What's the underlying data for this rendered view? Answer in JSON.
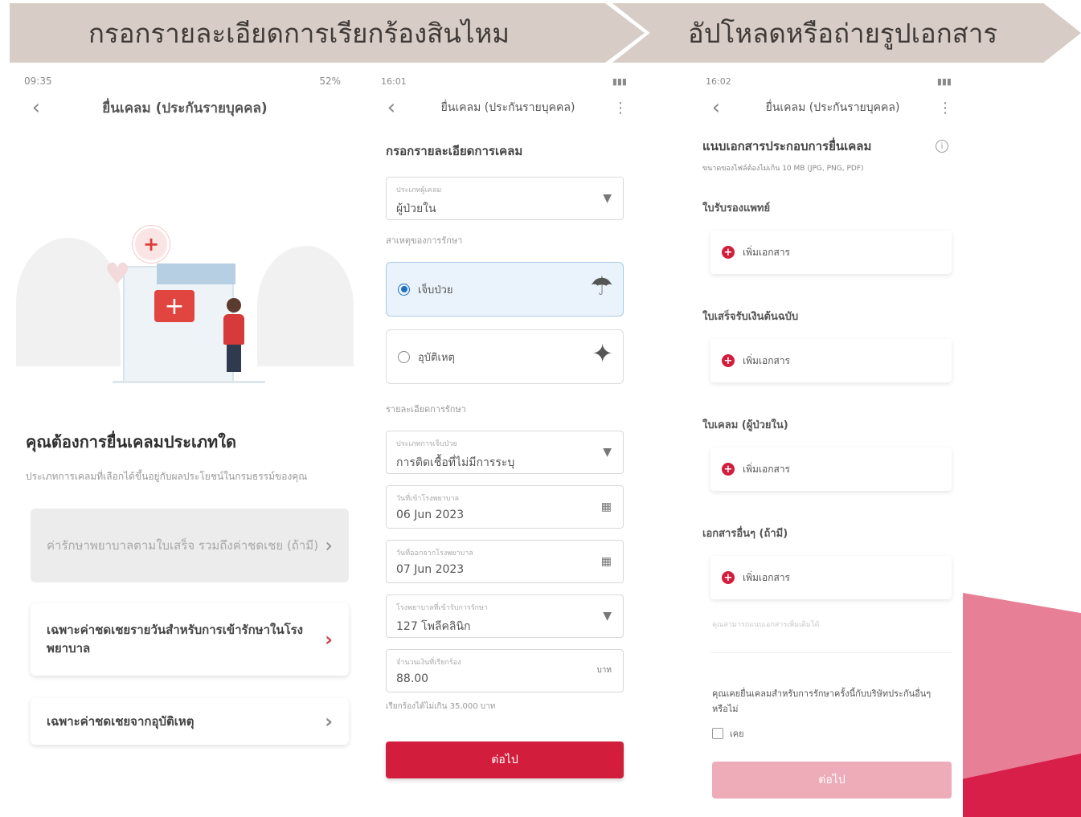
{
  "banners": {
    "step1": "กรอกรายละเอียดการเรียกร้องสินไหม",
    "step2": "อัปโหลดหรือถ่ายรูปเอกสาร"
  },
  "screen1": {
    "status_time": "09:35",
    "status_right": "52%",
    "title": "ยื่นเคลม (ประกันรายบุคคล)",
    "question": "คุณต้องการยื่นเคลมประเภทใด",
    "subtitle": "ประเภทการเคลมที่เลือกได้ขึ้นอยู่กับผลประโยชน์ในกรมธรรม์ของคุณ",
    "options": [
      {
        "label": "ค่ารักษาพยาบาลตามใบเสร็จ รวมถึงค่าชดเชย (ถ้ามี)",
        "disabled": true
      },
      {
        "label": "เฉพาะค่าชดเชยรายวันสำหรับการเข้ารักษาในโรงพยาบาล",
        "disabled": false
      },
      {
        "label": "เฉพาะค่าชดเชยจากอุบัติเหตุ",
        "disabled": false
      }
    ]
  },
  "screen2": {
    "status_time": "16:01",
    "title": "ยื่นเคลม (ประกันรายบุคคล)",
    "section1": "กรอกรายละเอียดการเคลม",
    "claimant_label": "ประเภทผู้เคลม",
    "claimant_value": "ผู้ป่วยใน",
    "cause_caption": "สาเหตุของการรักษา",
    "cause_options": [
      {
        "label": "เจ็บป่วย",
        "selected": true
      },
      {
        "label": "อุบัติเหตุ",
        "selected": false
      }
    ],
    "details_caption": "รายละเอียดการรักษา",
    "fields": [
      {
        "label": "ประเภทการเจ็บป่วย",
        "value": "การติดเชื้อที่ไม่มีการระบุ",
        "icon": "▼"
      },
      {
        "label": "วันที่เข้าโรงพยาบาล",
        "value": "06 Jun 2023",
        "icon": "▦"
      },
      {
        "label": "วันที่ออกจากโรงพยาบาล",
        "value": "07 Jun 2023",
        "icon": "▦"
      },
      {
        "label": "โรงพยาบาลที่เข้ารับการรักษา",
        "value": "127 โพลีคลินิก",
        "icon": "▼"
      },
      {
        "label": "จำนวนเงินที่เรียกร้อง",
        "value": "88.00",
        "icon": "บาท"
      }
    ],
    "amount_note": "เรียกร้องได้ไม่เกิน 35,000 บาท",
    "next_button": "ต่อไป"
  },
  "screen3": {
    "status_time": "16:02",
    "title": "ยื่นเคลม (ประกันรายบุคคล)",
    "header": "แนบเอกสารประกอบการยื่นเคลม",
    "subheader": "ขนาดของไฟล์ต้องไม่เกิน 10 MB (JPG, PNG, PDF)",
    "uploads": [
      {
        "label": "ใบรับรองแพทย์",
        "action": "เพิ่มเอกสาร"
      },
      {
        "label": "ใบเสร็จรับเงินต้นฉบับ",
        "action": "เพิ่มเอกสาร"
      },
      {
        "label": "ใบเคลม (ผู้ป่วยใน)",
        "action": "เพิ่มเอกสาร"
      },
      {
        "label": "เอกสารอื่นๆ (ถ้ามี)",
        "action": "เพิ่มเอกสาร"
      }
    ],
    "faint_note": "คุณสามารถแนบเอกสารเพิ่มเติมได้",
    "question": "คุณเคยยื่นเคลมสำหรับการรักษาครั้งนี้กับบริษัทประกันอื่นๆ หรือไม่",
    "checkbox_label": "เคย",
    "next_button": "ต่อไป"
  },
  "colors": {
    "banner": "#d7cdc6",
    "primary": "#d31d3c",
    "primary_disabled": "#eeabb8",
    "accent_pink": "#e77f96",
    "accent_red": "#d71f4a"
  }
}
